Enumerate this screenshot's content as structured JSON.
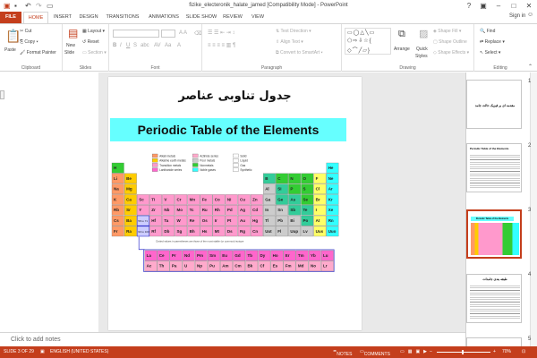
{
  "window": {
    "title": "fizike_electeronik_halate_jamed [Compatibility Mode] - PowerPoint",
    "help": "?"
  },
  "tabs": [
    "FILE",
    "HOME",
    "INSERT",
    "DESIGN",
    "TRANSITIONS",
    "ANIMATIONS",
    "SLIDE SHOW",
    "REVIEW",
    "VIEW"
  ],
  "account": {
    "signin": "Sign in"
  },
  "ribbon": {
    "clipboard": {
      "label": "Clipboard",
      "paste": "Paste",
      "cut": "Cut",
      "copy": "Copy",
      "format_painter": "Format Painter"
    },
    "slides": {
      "label": "Slides",
      "new_slide": "New",
      "new_slide2": "Slide",
      "layout": "Layout",
      "reset": "Reset",
      "section": "Section"
    },
    "font": {
      "label": "Font"
    },
    "paragraph": {
      "label": "Paragraph",
      "text_direction": "Text Direction",
      "align_text": "Align Text",
      "convert_smartart": "Convert to SmartArt"
    },
    "drawing": {
      "label": "Drawing",
      "arrange": "Arrange",
      "quick_styles": "Quick",
      "quick_styles2": "Styles",
      "shape_fill": "Shape Fill",
      "shape_outline": "Shape Outline",
      "shape_effects": "Shape Effects"
    },
    "editing": {
      "label": "Editing",
      "find": "Find",
      "replace": "Replace",
      "select": "Select"
    }
  },
  "slide": {
    "title_fa": "جدول تناوبی عناصر",
    "banner": "Periodic Table of the Elements",
    "footnote": "Dotted values in parentheses are those of the most stable (or common) isotope",
    "legend": [
      {
        "label": "Alkali metals",
        "color": "#ff9966"
      },
      {
        "label": "Alkaline earth metals",
        "color": "#ffcc00"
      },
      {
        "label": "Transition metals",
        "color": "#ff99cc"
      },
      {
        "label": "Lanthanide series",
        "color": "#ff66cc"
      },
      {
        "label": "Actinide series",
        "color": "#ffaacc"
      },
      {
        "label": "Poor metals",
        "color": "#cccccc"
      },
      {
        "label": "Nonmetals",
        "color": "#33cc33"
      },
      {
        "label": "Noble gases",
        "color": "#33ffff"
      },
      {
        "label": "Solid",
        "color": "#ffffff"
      },
      {
        "label": "Liquid",
        "color": "#ffffff"
      },
      {
        "label": "Gas",
        "color": "#ffffff"
      },
      {
        "label": "Synthetic",
        "color": "#ffffff"
      }
    ],
    "series_labels": [
      "58 to 71",
      "90 to 103"
    ],
    "lanthanides": [
      "La",
      "Ce",
      "Pr",
      "Nd",
      "Pm",
      "Sm",
      "Eu",
      "Gd",
      "Tb",
      "Dy",
      "Ho",
      "Er",
      "Tm",
      "Yb",
      "Lu"
    ],
    "actinides": [
      "Ac",
      "Th",
      "Pa",
      "U",
      "Np",
      "Pu",
      "Am",
      "Cm",
      "Bk",
      "Cf",
      "Es",
      "Fm",
      "Md",
      "No",
      "Lr"
    ],
    "main_rows": [
      [
        "H",
        "",
        "",
        "",
        "",
        "",
        "",
        "",
        "",
        "",
        "",
        "",
        "",
        "",
        "",
        "",
        "",
        "He"
      ],
      [
        "Li",
        "Be",
        "",
        "",
        "",
        "",
        "",
        "",
        "",
        "",
        "",
        "",
        "B",
        "C",
        "N",
        "O",
        "F",
        "Ne"
      ],
      [
        "Na",
        "Mg",
        "",
        "",
        "",
        "",
        "",
        "",
        "",
        "",
        "",
        "",
        "Al",
        "Si",
        "P",
        "S",
        "Cl",
        "Ar"
      ],
      [
        "K",
        "Ca",
        "Sc",
        "Ti",
        "V",
        "Cr",
        "Mn",
        "Fe",
        "Co",
        "Ni",
        "Cu",
        "Zn",
        "Ga",
        "Ge",
        "As",
        "Se",
        "Br",
        "Kr"
      ],
      [
        "Rb",
        "Sr",
        "Y",
        "Zr",
        "Nb",
        "Mo",
        "Tc",
        "Ru",
        "Rh",
        "Pd",
        "Ag",
        "Cd",
        "In",
        "Sn",
        "Sb",
        "Te",
        "I",
        "Xe"
      ],
      [
        "Cs",
        "Ba",
        "",
        "Hf",
        "Ta",
        "W",
        "Re",
        "Os",
        "Ir",
        "Pt",
        "Au",
        "Hg",
        "Tl",
        "Pb",
        "Bi",
        "Po",
        "At",
        "Rn"
      ],
      [
        "Fr",
        "Ra",
        "",
        "Rf",
        "Db",
        "Sg",
        "Bh",
        "Hs",
        "Mt",
        "Ds",
        "Rg",
        "Cn",
        "Uut",
        "Fl",
        "Uup",
        "Lv",
        "Uus",
        "Uuo"
      ]
    ]
  },
  "thumbnails": [
    {
      "num": "1",
      "text": "مقدمه ای بر فیزیک حالت جامد"
    },
    {
      "num": "2",
      "text": "Periodic Table of the Elements"
    },
    {
      "num": "3",
      "text": "Periodic Table of the Elements"
    },
    {
      "num": "4",
      "text": "طبقه بندی جامدات"
    },
    {
      "num": "5",
      "text": ""
    }
  ],
  "notes": {
    "placeholder": "Click to add notes"
  },
  "statusbar": {
    "slide": "SLIDE 3 OF 29",
    "language": "ENGLISH (UNITED STATES)",
    "notes": "NOTES",
    "comments": "COMMENTS",
    "zoom": "70%"
  },
  "colors": {
    "accent": "#c43e1c",
    "banner": "#66ffff"
  }
}
